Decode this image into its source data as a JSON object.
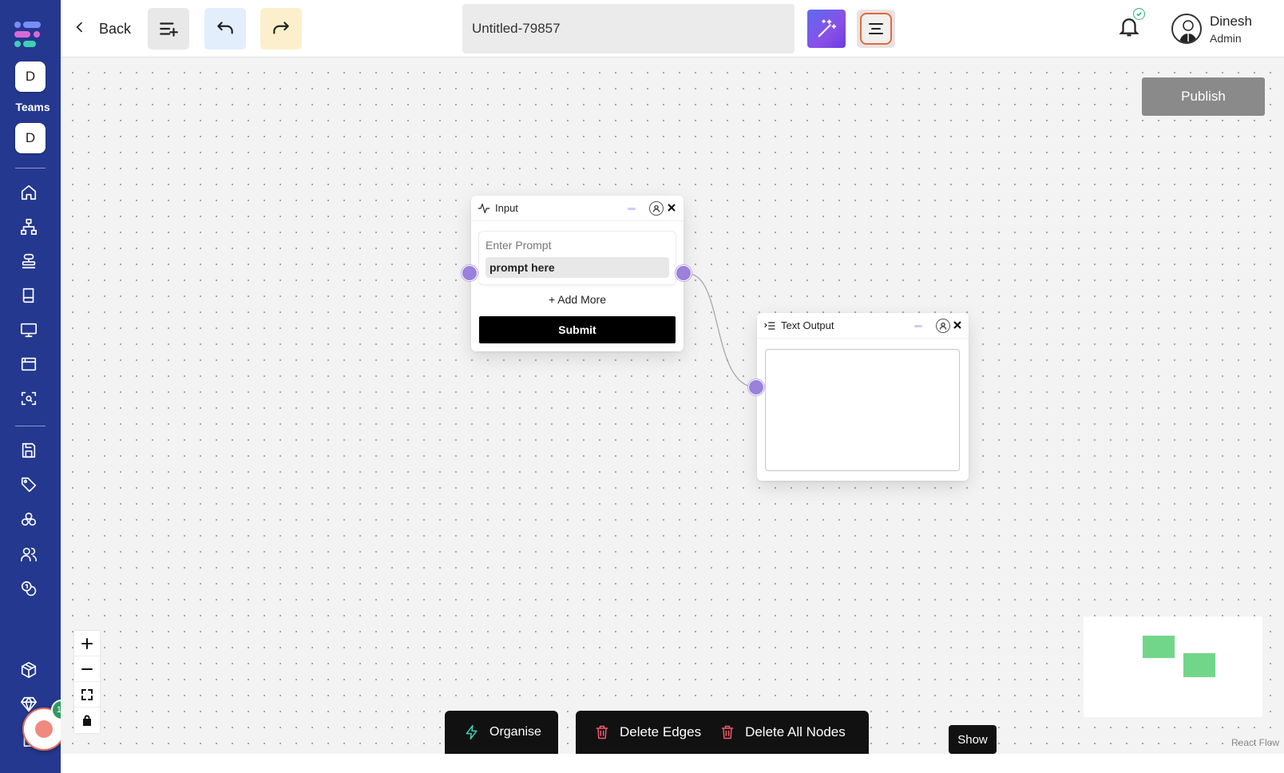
{
  "sidebar": {
    "team_initial_1": "D",
    "team_initial_2": "D",
    "teams_label": "Teams",
    "notification_count": "10",
    "nav_icons": [
      "home-icon",
      "workflow-icon",
      "stack-icon",
      "book-icon",
      "monitor-icon",
      "browser-icon",
      "scan-icon",
      "save-icon",
      "tag-icon",
      "components-icon",
      "users-icon",
      "coins-icon",
      "package-icon",
      "diamond-icon",
      "document-icon"
    ]
  },
  "header": {
    "back_label": "Back",
    "title_value": "Untitled-79857",
    "user_name": "Dinesh",
    "user_role": "Admin",
    "colors": {
      "add_button_bg": "#e8e8e8",
      "undo_button_bg": "#e3eefc",
      "redo_button_bg": "#fcf0cc",
      "magic_button_gradient": [
        "#5b6cf0",
        "#8a4fe6"
      ],
      "menu_button_border": "#e06a3e"
    }
  },
  "canvas": {
    "publish_label": "Publish",
    "input_node": {
      "title": "Input",
      "prompt_label": "Enter Prompt",
      "prompt_value": "prompt here",
      "add_more_label": "+ Add More",
      "submit_label": "Submit"
    },
    "output_node": {
      "title": "Text Output"
    },
    "handle_color": "#9b80dc",
    "organise_label": "Organise",
    "delete_edges_label": "Delete Edges",
    "delete_all_nodes_label": "Delete All Nodes",
    "show_label": "Show",
    "attribution": "React Flow",
    "minimap_node_color": "#72d68a"
  }
}
